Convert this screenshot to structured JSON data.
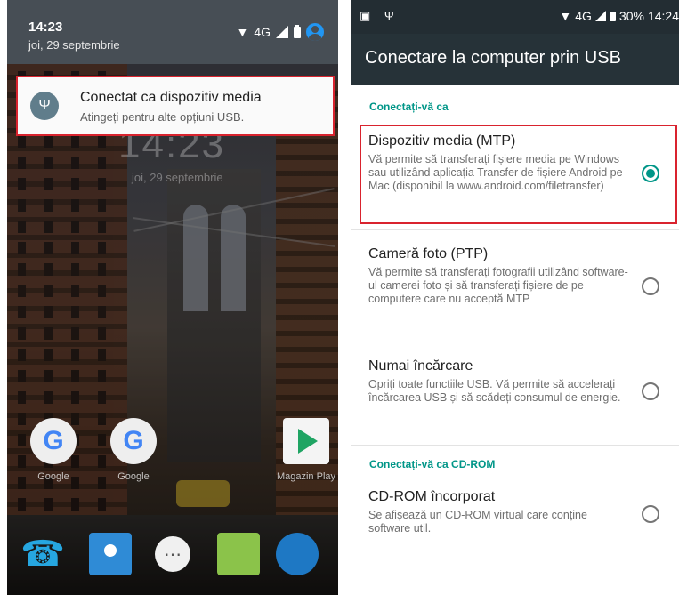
{
  "left": {
    "status": {
      "time": "14:23",
      "date": "joi, 29 septembrie",
      "network": "4G"
    },
    "notification": {
      "icon": "usb-icon",
      "title": "Conectat ca dispozitiv media",
      "subtitle": "Atingeți pentru alte opțiuni USB."
    },
    "lockscreen": {
      "clock": "14:23",
      "date": "joi, 29 septembrie"
    },
    "apps": [
      {
        "label": "Google",
        "icon": "google-icon"
      },
      {
        "label": "Google",
        "icon": "google-icon"
      },
      {
        "label": "Magazin Play",
        "icon": "play-store-icon"
      }
    ],
    "dock": [
      "phone-icon",
      "contacts-icon",
      "app-drawer-icon",
      "messages-icon",
      "browser-icon"
    ]
  },
  "right": {
    "status": {
      "network": "4G",
      "battery": "30%",
      "time": "14:24"
    },
    "title": "Conectare la computer prin USB",
    "sections": {
      "connect_as": "Conectați-vă ca",
      "connect_cdrom": "Conectați-vă ca CD-ROM"
    },
    "options": [
      {
        "name": "Dispozitiv media (MTP)",
        "desc": "Vă permite să transferați fișiere media pe Windows sau utilizând aplicația Transfer de fișiere Android pe Mac (disponibil la www.android.com/filetransfer)",
        "selected": true
      },
      {
        "name": "Cameră foto (PTP)",
        "desc": "Vă permite să transferați fotografii utilizând software-ul camerei foto și să transferați fișiere de pe computere care nu acceptă MTP",
        "selected": false
      },
      {
        "name": "Numai încărcare",
        "desc": "Opriți toate funcțiile USB. Vă permite să accelerați încărcarea USB și să scădeți consumul de energie.",
        "selected": false
      },
      {
        "name": "CD-ROM încorporat",
        "desc": "Se afișează un CD-ROM virtual care conține software util.",
        "selected": false
      }
    ]
  },
  "colors": {
    "accent": "#009688",
    "highlight": "#d9232e",
    "appbar": "#263238"
  }
}
